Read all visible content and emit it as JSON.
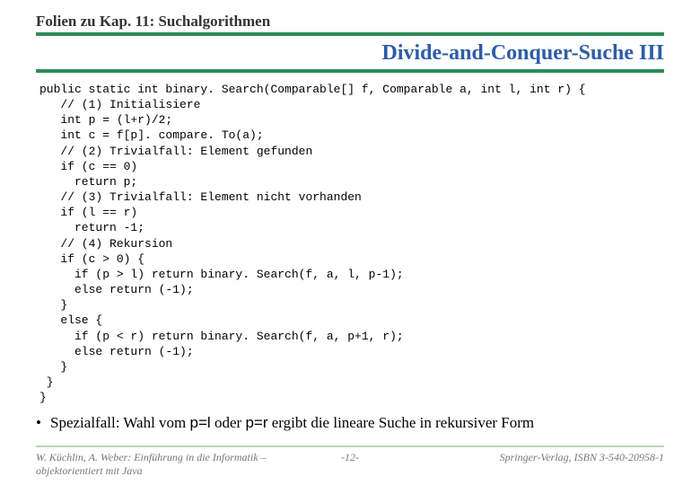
{
  "header": {
    "chapter": "Folien zu Kap. 11: Suchalgorithmen"
  },
  "slide": {
    "title": "Divide-and-Conquer-Suche III"
  },
  "code": {
    "lines": [
      "public static int binary. Search(Comparable[] f, Comparable a, int l, int r) {",
      "   // (1) Initialisiere",
      "   int p = (l+r)/2;",
      "   int c = f[p]. compare. To(a);",
      "   // (2) Trivialfall: Element gefunden",
      "   if (c == 0)",
      "     return p;",
      "   // (3) Trivialfall: Element nicht vorhanden",
      "   if (l == r)",
      "     return -1;",
      "   // (4) Rekursion",
      "   if (c > 0) {",
      "     if (p > l) return binary. Search(f, a, l, p-1);",
      "     else return (-1);",
      "   }",
      "   else {",
      "     if (p < r) return binary. Search(f, a, p+1, r);",
      "     else return (-1);",
      "   }",
      " }",
      "}"
    ]
  },
  "bullet": {
    "prefix": "Spezialfall: Wahl vom ",
    "code1": "p=l",
    "mid": " oder ",
    "code2": "p=r",
    "suffix": " ergibt die lineare Suche in rekursiver Form"
  },
  "footer": {
    "left": "W. Küchlin, A. Weber: Einführung in die Informatik – objektorientiert mit Java",
    "mid": "-12-",
    "right": "Springer-Verlag, ISBN 3-540-20958-1"
  }
}
